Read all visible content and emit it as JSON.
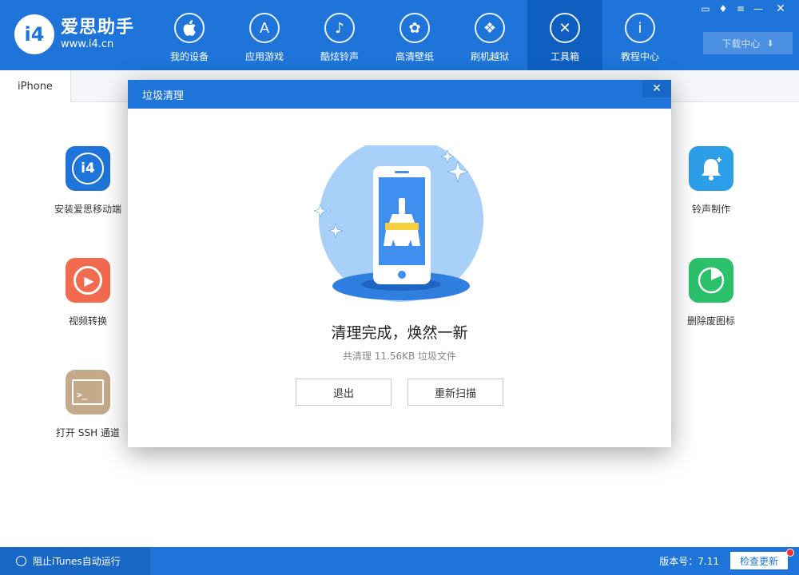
{
  "app": {
    "logo_mark": "i4",
    "title": "爱思助手",
    "url": "www.i4.cn"
  },
  "nav": [
    {
      "label": "我的设备",
      "icon": "apple-icon",
      "glyph": "",
      "active": false
    },
    {
      "label": "应用游戏",
      "icon": "app-store-icon",
      "glyph": "A",
      "active": false
    },
    {
      "label": "酷炫铃声",
      "icon": "bell-icon",
      "glyph": "♪",
      "active": false
    },
    {
      "label": "高清壁纸",
      "icon": "flower-icon",
      "glyph": "✿",
      "active": false
    },
    {
      "label": "刷机越狱",
      "icon": "dropbox-icon",
      "glyph": "❖",
      "active": false
    },
    {
      "label": "工具箱",
      "icon": "tools-icon",
      "glyph": "✕",
      "active": true
    },
    {
      "label": "教程中心",
      "icon": "info-icon",
      "glyph": "i",
      "active": false
    }
  ],
  "window": {
    "download_label": "下载中心"
  },
  "tab": {
    "label": "iPhone"
  },
  "tools": {
    "install_mobile": {
      "label": "安装爱思移动端",
      "color": "#1e74d8",
      "glyph": "i4"
    },
    "video_convert": {
      "label": "视频转换",
      "color": "#f26b4f",
      "glyph": "▶"
    },
    "ssh": {
      "label": "打开 SSH 通道",
      "color": "#c4aa8a",
      "glyph": ">_"
    },
    "ringtone": {
      "label": "铃声制作",
      "color": "#2d9ee8",
      "glyph": "♪"
    },
    "delete_icon": {
      "label": "删除废图标",
      "color": "#2bc06a",
      "glyph": "◔"
    }
  },
  "dialog": {
    "title": "垃圾清理",
    "close_glyph": "✕",
    "result_title": "清理完成，焕然一新",
    "result_subtitle": "共清理 11.56KB 垃圾文件",
    "exit_label": "退出",
    "rescan_label": "重新扫描"
  },
  "status": {
    "itunes_label": "阻止iTunes自动运行",
    "version_label": "版本号：7.11",
    "update_label": "检查更新"
  }
}
